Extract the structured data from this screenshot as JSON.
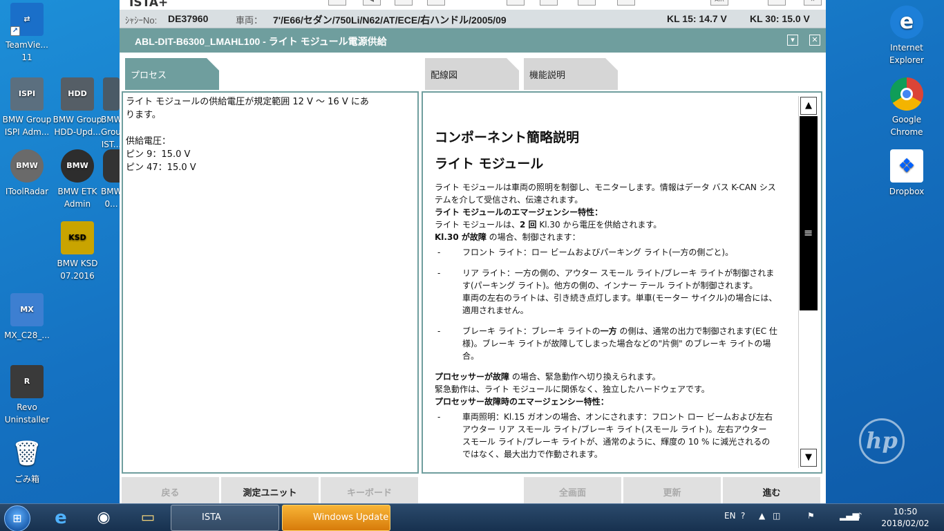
{
  "desktop": {
    "icons": [
      {
        "label": "TeamVie...\n11",
        "glyph": "TV",
        "color": "#1a6fc9"
      },
      {
        "label": "BMW Group ISPI Adm...",
        "glyph": "ISPI",
        "color": "#5b6f7f"
      },
      {
        "label": "BMW Group HDD-Upd...",
        "glyph": "HDD",
        "color": "#555e66"
      },
      {
        "label": "BMW Group IST...",
        "glyph": "IS",
        "color": "#4a5a66"
      },
      {
        "label": "IToolRadar",
        "glyph": "BMW",
        "color": "#6a6a6a"
      },
      {
        "label": "BMW ETK Admin",
        "glyph": "BMW",
        "color": "#2d2d2d"
      },
      {
        "label": "BMW 0...",
        "glyph": "B",
        "color": "#333"
      },
      {
        "label": "BMW KSD 07.2016",
        "glyph": "KSD",
        "color": "#c9a400"
      },
      {
        "label": "MX_C28_...",
        "glyph": "MX",
        "color": "#3d7fd1"
      },
      {
        "label": "Revo Uninstaller",
        "glyph": "R",
        "color": "#3a3a3a"
      },
      {
        "label": "ごみ箱",
        "glyph": "🗑",
        "color": "transparent"
      },
      {
        "label": "Internet Explorer",
        "glyph": "e",
        "color": "#1d7fd8"
      },
      {
        "label": "Google Chrome",
        "glyph": "◉",
        "color": "#e8e8e8"
      },
      {
        "label": "Dropbox",
        "glyph": "❖",
        "color": "#ffffff"
      }
    ],
    "hp_logo": "hp"
  },
  "ista": {
    "app_name": "ISTA+",
    "vehicle": {
      "chassis_label": "ｼｬｼｰNo:",
      "chassis_no": "DE37960",
      "vehicle_label": "車両：",
      "vehicle_desc": "7'/E66/セダン/750Li/N62/AT/ECE/右ハンドル/2005/09",
      "kl15": "KL 15:  14.7 V",
      "kl30": "KL 30:  15.0 V"
    },
    "title": "ABL-DIT-B6300_LMAHL100 - ライト モジュール電源供給",
    "tabs": {
      "process": "プロセス",
      "wiring": "配線図",
      "function": "機能説明"
    },
    "left_panel": {
      "line1": "ライト モジュールの供給電圧が規定範囲 12 V ～ 16 V にあ",
      "line2": "ります。",
      "supply_label": "供給電圧：",
      "pin9": "ピン 9：15.0 V",
      "pin47": "ピン 47：15.0 V"
    },
    "right_panel": {
      "heading1": "コンポーネント簡略説明",
      "heading2": "ライト モジュール",
      "p1": "ライト モジュールは車両の照明を制御し、モニターします。情報はデータ バス K-CAN システムを介して受信され、伝達されます。",
      "p2": "ライト モジュールのエマージェンシー特性：",
      "p3a": "ライト モジュールは、",
      "p3b": "2 回",
      "p3c": " Kl.30 から電圧を供給されます。",
      "p4a": "Kl.30 が故障",
      "p4b": " の場合、制御されます：",
      "b1": "フロント ライト：ロー ビームおよびパーキング ライト(一方の側ごと)。",
      "b2a": "リア ライト：一方の側の、アウター スモール ライト/ブレーキ ライトが制御されます(パーキング ライト)。他方の側の、インナー テール ライトが制御されます。",
      "b2b": "車両の左右のライトは、引き続き点灯します。単車(モーター サイクル)の場合には、適用されません。",
      "b3a": "ブレーキ ライト：ブレーキ ライトの",
      "b3b": "一方",
      "b3c": " の側は、通常の出力で制御されます(EC 仕様)。ブレーキ ライトが故障してしまった場合などの\"片側\" のブレーキ ライトの場合。",
      "p5a": "プロセッサーが故障",
      "p5b": " の場合、緊急動作へ切り換えられます。",
      "p6": "緊急動作は、ライト モジュールに関係なく、独立したハードウェアです。",
      "p7": "プロセッサー故障時のエマージェンシー特性：",
      "b4": "車両照明：Kl.15 ガオンの場合、オンにされます：フロント ロー ビームおよび左右アウター リア スモール ライト/ブレーキ ライト(スモール ライト)。左右アウター スモール ライト/ブレーキ ライトが、通常のように、輝度の 10 % に減光されるのではなく、最大出力で作動されます。"
    },
    "buttons": {
      "back": "戻る",
      "measure": "測定ユニット",
      "keyboard": "キーボード",
      "fullscreen": "全画面",
      "refresh": "更新",
      "next": "進む"
    }
  },
  "taskbar": {
    "tasks": [
      {
        "label": "ISTA"
      },
      {
        "label": "Windows Update"
      }
    ],
    "lang": "EN",
    "time": "10:50",
    "date": "2018/02/02"
  }
}
